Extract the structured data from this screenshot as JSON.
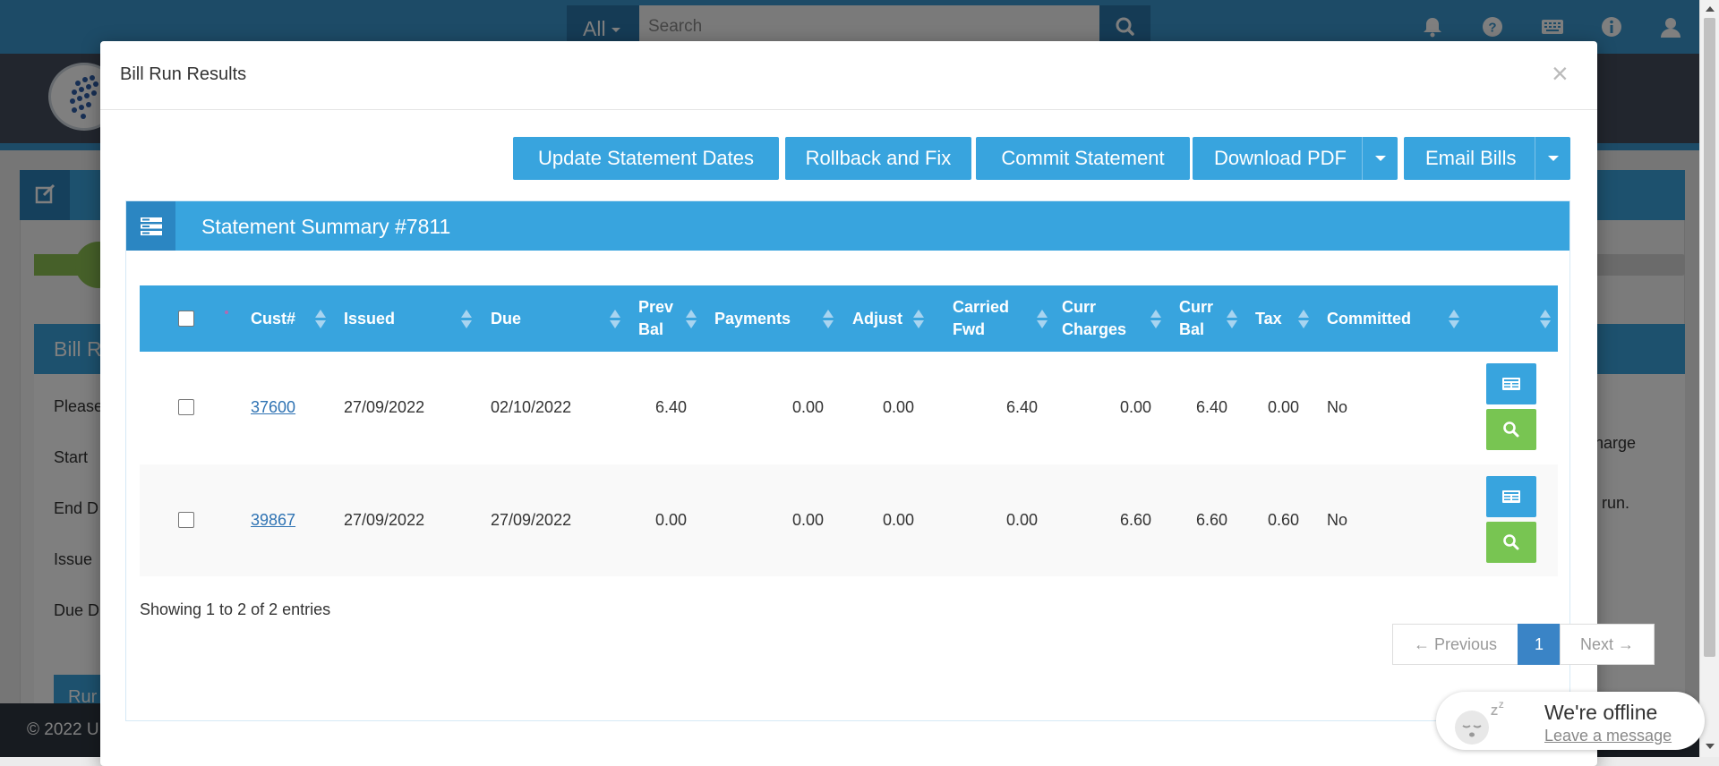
{
  "topbar": {
    "search_scope": "All",
    "search_placeholder": "Search"
  },
  "background": {
    "card_title": "Bill R",
    "labels": [
      "Please",
      "Start",
      "End D",
      "Issue",
      "Due D"
    ],
    "right_text_1": "charge",
    "right_text_2": "ill run.",
    "run_button": "Rur",
    "footer": "© 2022 U"
  },
  "modal": {
    "title": "Bill Run Results",
    "close": "×",
    "buttons": {
      "update_statement_dates": "Update Statement Dates",
      "rollback_and_fix": "Rollback and Fix",
      "commit_statement": "Commit Statement",
      "download_pdf": "Download PDF",
      "email_bills": "Email Bills"
    },
    "panel_title": "Statement Summary #7811",
    "table": {
      "columns": {
        "cust": "Cust#",
        "issued": "Issued",
        "due": "Due",
        "prev_bal_1": "Prev",
        "prev_bal_2": "Bal",
        "payments": "Payments",
        "adjust": "Adjust",
        "carried_fwd_1": "Carried",
        "carried_fwd_2": "Fwd",
        "curr_charges_1": "Curr",
        "curr_charges_2": "Charges",
        "curr_bal_1": "Curr",
        "curr_bal_2": "Bal",
        "tax": "Tax",
        "committed": "Committed"
      },
      "rows": [
        {
          "cust": "37600",
          "issued": "27/09/2022",
          "due": "02/10/2022",
          "prev_bal": "6.40",
          "payments": "0.00",
          "adjust": "0.00",
          "carried_fwd": "6.40",
          "curr_charges": "0.00",
          "curr_bal": "6.40",
          "tax": "0.00",
          "committed": "No"
        },
        {
          "cust": "39867",
          "issued": "27/09/2022",
          "due": "27/09/2022",
          "prev_bal": "0.00",
          "payments": "0.00",
          "adjust": "0.00",
          "carried_fwd": "0.00",
          "curr_charges": "6.60",
          "curr_bal": "6.60",
          "tax": "0.60",
          "committed": "No"
        }
      ]
    },
    "showing": "Showing 1 to 2 of 2 entries",
    "pagination": {
      "previous": "← Previous",
      "current": "1",
      "next": "Next →"
    }
  },
  "chat": {
    "title": "We're offline",
    "link": "Leave a message"
  },
  "colors": {
    "primary": "#38a4de",
    "primary_dark": "#2b86c2",
    "success": "#78c552",
    "page_active": "#3a84c6",
    "link": "#2f73b3"
  },
  "icons": {
    "top": [
      "bell-icon",
      "help-icon",
      "keyboard-icon",
      "info-icon",
      "user-icon"
    ],
    "row_actions": [
      "statement-icon",
      "search-icon"
    ],
    "panel": "statement-list-icon"
  }
}
